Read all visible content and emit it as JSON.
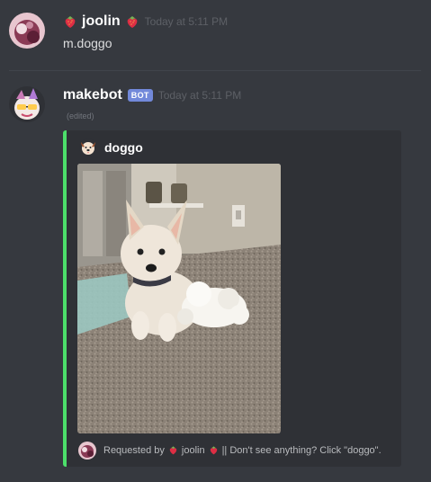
{
  "messages": [
    {
      "author": "joolin",
      "timestamp": "Today at 5:11 PM",
      "content": "m.doggo",
      "author_emoji": "strawberry-icon"
    },
    {
      "author": "makebot",
      "bot_tag": "BOT",
      "timestamp": "Today at 5:11 PM",
      "edited": "(edited)",
      "embed": {
        "accent_color": "#4cdf6a",
        "author_name": "doggo",
        "author_icon": "dog-face-icon",
        "image": "puppy-with-plush-toy-photo",
        "footer": {
          "requested_by": "Requested by",
          "user": "joolin",
          "suffix": "|| Don't see anything? Click \"doggo\"."
        }
      }
    }
  ],
  "colors": {
    "background": "#36393f",
    "embed_background": "#2f3136",
    "bot_tag": "#7289da",
    "username": "#ffffff",
    "timestamp": "#5d6066"
  }
}
